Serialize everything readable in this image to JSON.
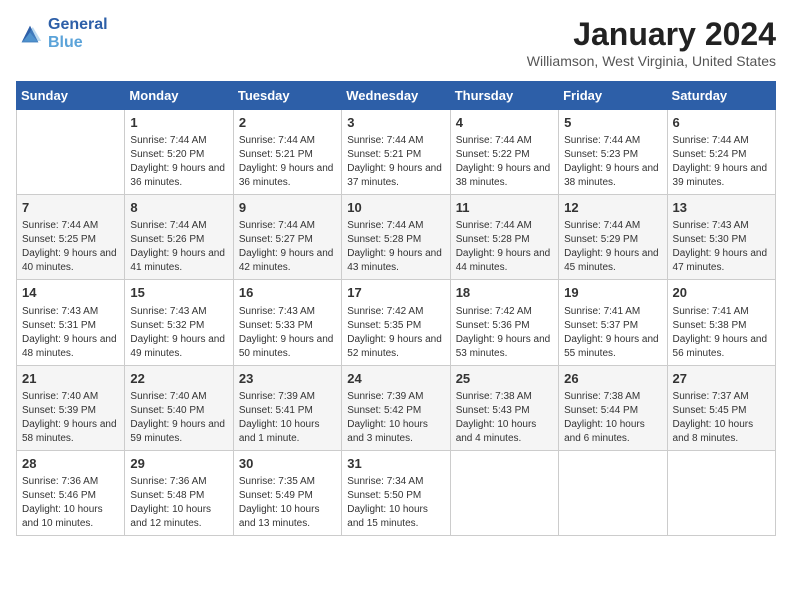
{
  "header": {
    "logo_line1": "General",
    "logo_line2": "Blue",
    "month": "January 2024",
    "location": "Williamson, West Virginia, United States"
  },
  "days_of_week": [
    "Sunday",
    "Monday",
    "Tuesday",
    "Wednesday",
    "Thursday",
    "Friday",
    "Saturday"
  ],
  "weeks": [
    [
      {
        "day": "",
        "info": ""
      },
      {
        "day": "1",
        "info": "Sunrise: 7:44 AM\nSunset: 5:20 PM\nDaylight: 9 hours and 36 minutes."
      },
      {
        "day": "2",
        "info": "Sunrise: 7:44 AM\nSunset: 5:21 PM\nDaylight: 9 hours and 36 minutes."
      },
      {
        "day": "3",
        "info": "Sunrise: 7:44 AM\nSunset: 5:21 PM\nDaylight: 9 hours and 37 minutes."
      },
      {
        "day": "4",
        "info": "Sunrise: 7:44 AM\nSunset: 5:22 PM\nDaylight: 9 hours and 38 minutes."
      },
      {
        "day": "5",
        "info": "Sunrise: 7:44 AM\nSunset: 5:23 PM\nDaylight: 9 hours and 38 minutes."
      },
      {
        "day": "6",
        "info": "Sunrise: 7:44 AM\nSunset: 5:24 PM\nDaylight: 9 hours and 39 minutes."
      }
    ],
    [
      {
        "day": "7",
        "info": "Sunrise: 7:44 AM\nSunset: 5:25 PM\nDaylight: 9 hours and 40 minutes."
      },
      {
        "day": "8",
        "info": "Sunrise: 7:44 AM\nSunset: 5:26 PM\nDaylight: 9 hours and 41 minutes."
      },
      {
        "day": "9",
        "info": "Sunrise: 7:44 AM\nSunset: 5:27 PM\nDaylight: 9 hours and 42 minutes."
      },
      {
        "day": "10",
        "info": "Sunrise: 7:44 AM\nSunset: 5:28 PM\nDaylight: 9 hours and 43 minutes."
      },
      {
        "day": "11",
        "info": "Sunrise: 7:44 AM\nSunset: 5:28 PM\nDaylight: 9 hours and 44 minutes."
      },
      {
        "day": "12",
        "info": "Sunrise: 7:44 AM\nSunset: 5:29 PM\nDaylight: 9 hours and 45 minutes."
      },
      {
        "day": "13",
        "info": "Sunrise: 7:43 AM\nSunset: 5:30 PM\nDaylight: 9 hours and 47 minutes."
      }
    ],
    [
      {
        "day": "14",
        "info": "Sunrise: 7:43 AM\nSunset: 5:31 PM\nDaylight: 9 hours and 48 minutes."
      },
      {
        "day": "15",
        "info": "Sunrise: 7:43 AM\nSunset: 5:32 PM\nDaylight: 9 hours and 49 minutes."
      },
      {
        "day": "16",
        "info": "Sunrise: 7:43 AM\nSunset: 5:33 PM\nDaylight: 9 hours and 50 minutes."
      },
      {
        "day": "17",
        "info": "Sunrise: 7:42 AM\nSunset: 5:35 PM\nDaylight: 9 hours and 52 minutes."
      },
      {
        "day": "18",
        "info": "Sunrise: 7:42 AM\nSunset: 5:36 PM\nDaylight: 9 hours and 53 minutes."
      },
      {
        "day": "19",
        "info": "Sunrise: 7:41 AM\nSunset: 5:37 PM\nDaylight: 9 hours and 55 minutes."
      },
      {
        "day": "20",
        "info": "Sunrise: 7:41 AM\nSunset: 5:38 PM\nDaylight: 9 hours and 56 minutes."
      }
    ],
    [
      {
        "day": "21",
        "info": "Sunrise: 7:40 AM\nSunset: 5:39 PM\nDaylight: 9 hours and 58 minutes."
      },
      {
        "day": "22",
        "info": "Sunrise: 7:40 AM\nSunset: 5:40 PM\nDaylight: 9 hours and 59 minutes."
      },
      {
        "day": "23",
        "info": "Sunrise: 7:39 AM\nSunset: 5:41 PM\nDaylight: 10 hours and 1 minute."
      },
      {
        "day": "24",
        "info": "Sunrise: 7:39 AM\nSunset: 5:42 PM\nDaylight: 10 hours and 3 minutes."
      },
      {
        "day": "25",
        "info": "Sunrise: 7:38 AM\nSunset: 5:43 PM\nDaylight: 10 hours and 4 minutes."
      },
      {
        "day": "26",
        "info": "Sunrise: 7:38 AM\nSunset: 5:44 PM\nDaylight: 10 hours and 6 minutes."
      },
      {
        "day": "27",
        "info": "Sunrise: 7:37 AM\nSunset: 5:45 PM\nDaylight: 10 hours and 8 minutes."
      }
    ],
    [
      {
        "day": "28",
        "info": "Sunrise: 7:36 AM\nSunset: 5:46 PM\nDaylight: 10 hours and 10 minutes."
      },
      {
        "day": "29",
        "info": "Sunrise: 7:36 AM\nSunset: 5:48 PM\nDaylight: 10 hours and 12 minutes."
      },
      {
        "day": "30",
        "info": "Sunrise: 7:35 AM\nSunset: 5:49 PM\nDaylight: 10 hours and 13 minutes."
      },
      {
        "day": "31",
        "info": "Sunrise: 7:34 AM\nSunset: 5:50 PM\nDaylight: 10 hours and 15 minutes."
      },
      {
        "day": "",
        "info": ""
      },
      {
        "day": "",
        "info": ""
      },
      {
        "day": "",
        "info": ""
      }
    ]
  ]
}
